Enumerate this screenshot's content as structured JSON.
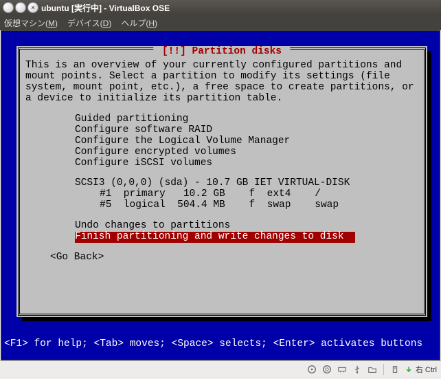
{
  "window": {
    "title": "ubuntu [実行中] - VirtualBox OSE"
  },
  "menubar": {
    "vm": "仮想マシン(M)",
    "device": "デバイス(D)",
    "help": "ヘルプ(H)"
  },
  "dialog": {
    "title": "[!!] Partition disks",
    "body": "This is an overview of your currently configured partitions and mount points. Select a partition to modify its settings (file system, mount point, etc.), a free space to create partitions, or a device to initialize its partition table.",
    "menu": [
      "Guided partitioning",
      "Configure software RAID",
      "Configure the Logical Volume Manager",
      "Configure encrypted volumes",
      "Configure iSCSI volumes"
    ],
    "disk_header": "SCSI3 (0,0,0) (sda) - 10.7 GB IET VIRTUAL-DISK",
    "partitions": [
      "#1  primary   10.2 GB    f  ext4    /",
      "#5  logical  504.4 MB    f  swap    swap"
    ],
    "undo": "Undo changes to partitions",
    "finish": "Finish partitioning and write changes to disk",
    "go_back": "<Go Back>"
  },
  "help_line": "<F1> for help; <Tab> moves; <Space> selects; <Enter> activates buttons",
  "statusbar": {
    "host_key": "右 Ctrl"
  }
}
